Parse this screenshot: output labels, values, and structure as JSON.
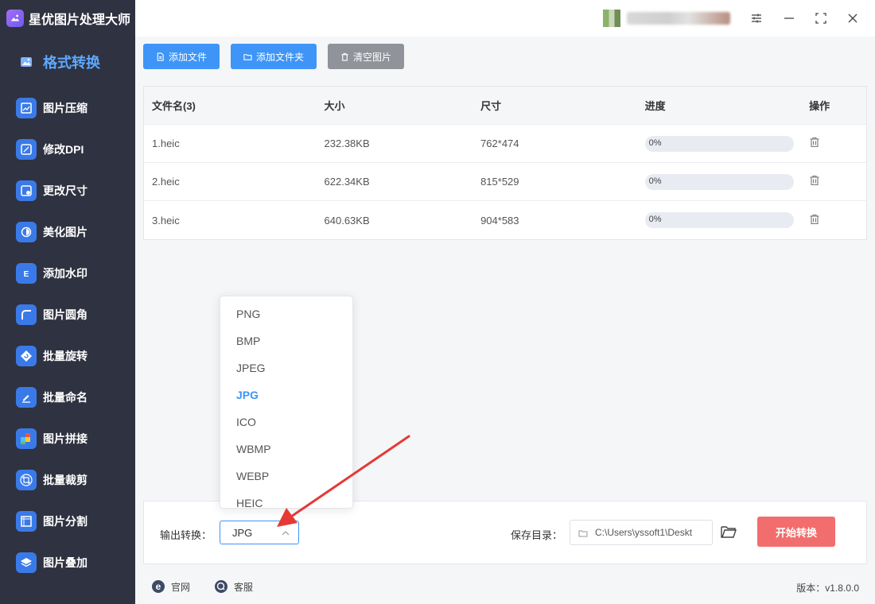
{
  "app": {
    "name": "星优图片处理大师"
  },
  "sidebar": {
    "items": [
      {
        "label": "格式转换",
        "icon": "image-convert-icon",
        "color": "#4a90f0",
        "active": true
      },
      {
        "label": "图片压缩",
        "icon": "compress-icon",
        "color": "#3a7ae8",
        "active": false
      },
      {
        "label": "修改DPI",
        "icon": "dpi-icon",
        "color": "#3a7ae8",
        "active": false
      },
      {
        "label": "更改尺寸",
        "icon": "resize-icon",
        "color": "#3a7ae8",
        "active": false
      },
      {
        "label": "美化图片",
        "icon": "beautify-icon",
        "color": "#3a7ae8",
        "active": false
      },
      {
        "label": "添加水印",
        "icon": "watermark-icon",
        "color": "#3a7ae8",
        "active": false
      },
      {
        "label": "图片圆角",
        "icon": "round-corner-icon",
        "color": "#3a7ae8",
        "active": false
      },
      {
        "label": "批量旋转",
        "icon": "rotate-icon",
        "color": "#3a7ae8",
        "active": false
      },
      {
        "label": "批量命名",
        "icon": "rename-icon",
        "color": "#3a7ae8",
        "active": false
      },
      {
        "label": "图片拼接",
        "icon": "puzzle-icon",
        "color": "#3a7ae8",
        "active": false
      },
      {
        "label": "批量裁剪",
        "icon": "crop-icon",
        "color": "#3a7ae8",
        "active": false
      },
      {
        "label": "图片分割",
        "icon": "split-icon",
        "color": "#3a7ae8",
        "active": false
      },
      {
        "label": "图片叠加",
        "icon": "layers-icon",
        "color": "#3a7ae8",
        "active": false
      }
    ]
  },
  "toolbar": {
    "add_file": "添加文件",
    "add_folder": "添加文件夹",
    "clear": "清空图片"
  },
  "table": {
    "headers": [
      "文件名(3)",
      "大小",
      "尺寸",
      "进度",
      "操作"
    ],
    "rows": [
      {
        "name": "1.heic",
        "size": "232.38KB",
        "dimensions": "762*474",
        "progress": "0%"
      },
      {
        "name": "2.heic",
        "size": "622.34KB",
        "dimensions": "815*529",
        "progress": "0%"
      },
      {
        "name": "3.heic",
        "size": "640.63KB",
        "dimensions": "904*583",
        "progress": "0%"
      }
    ]
  },
  "output": {
    "label": "输出转换：",
    "selected": "JPG",
    "options": [
      "PNG",
      "BMP",
      "JPEG",
      "JPG",
      "ICO",
      "WBMP",
      "WEBP",
      "HEIC"
    ]
  },
  "save": {
    "label": "保存目录：",
    "path": "C:\\Users\\yssoft1\\Deskt"
  },
  "start_button": "开始转换",
  "footer": {
    "website": "官网",
    "service": "客服",
    "version": "版本：v1.8.0.0"
  },
  "colors": {
    "accent": "#3e95f7",
    "start": "#f26d6d",
    "sidebar_bg": "#2f3240",
    "annotation_arrow": "#e53935"
  }
}
